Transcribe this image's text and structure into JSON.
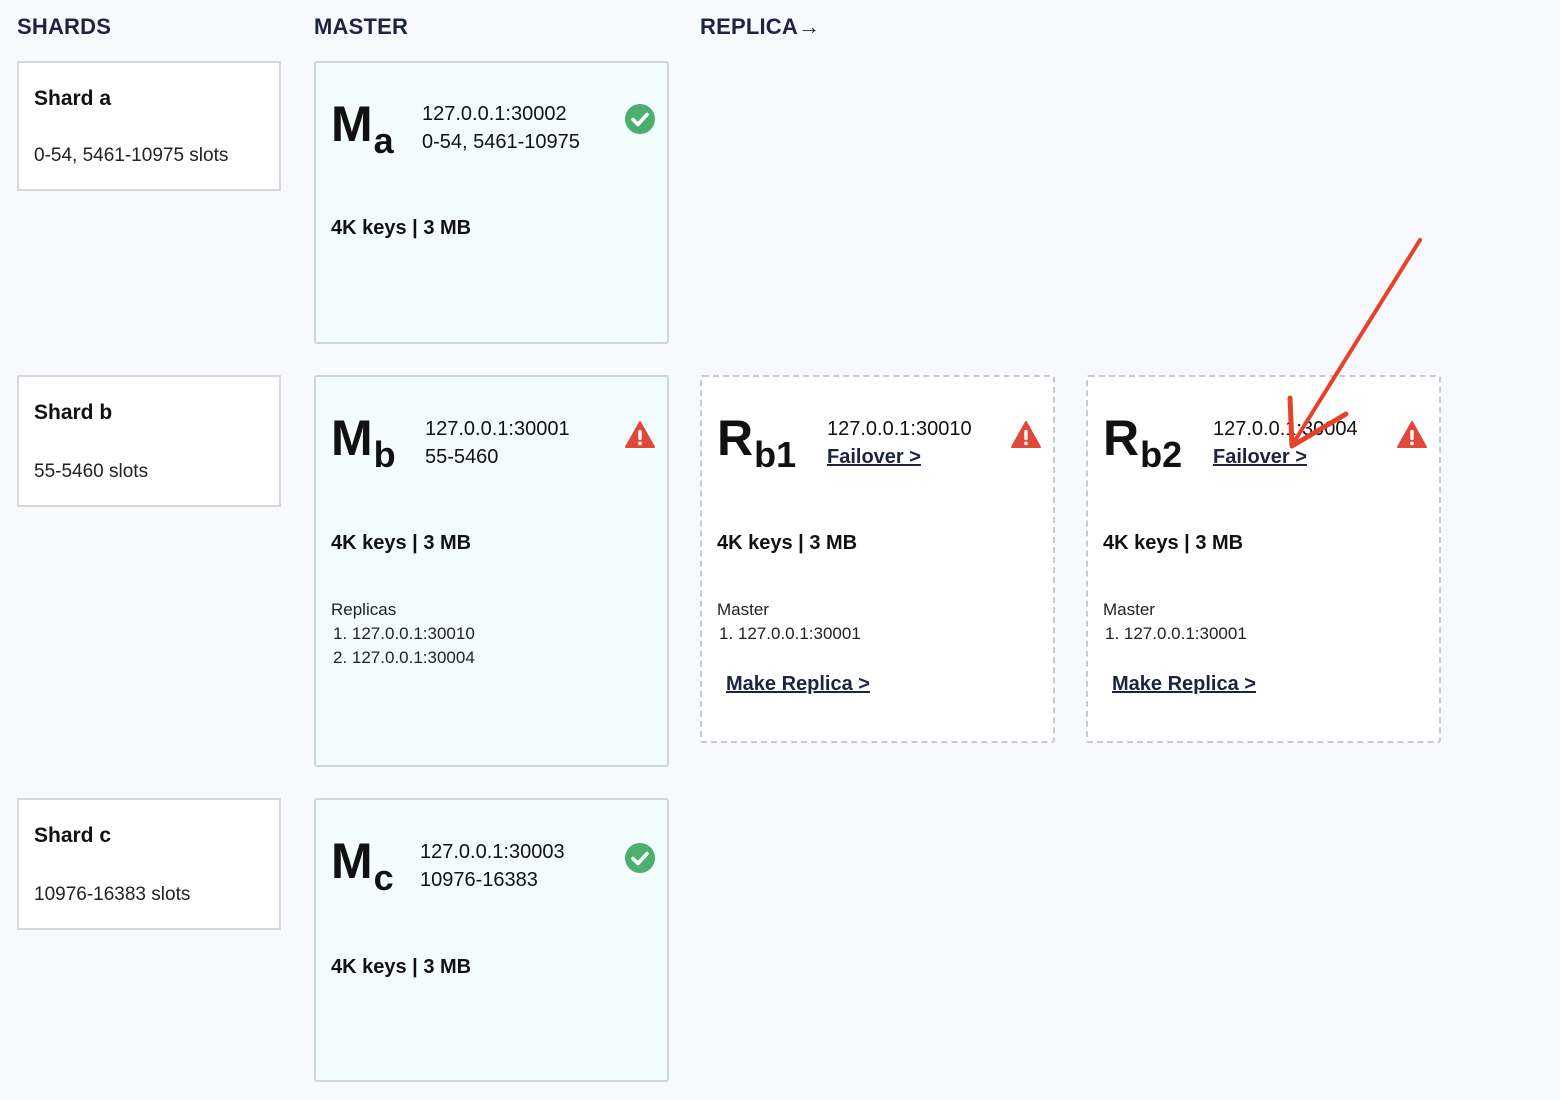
{
  "headers": {
    "shards": "SHARDS",
    "master": "MASTER",
    "replica": "REPLICA→"
  },
  "shards": [
    {
      "name": "Shard a",
      "slots": "0-54, 5461-10975 slots"
    },
    {
      "name": "Shard b",
      "slots": "55-5460 slots"
    },
    {
      "name": "Shard c",
      "slots": "10976-16383 slots"
    }
  ],
  "masters": [
    {
      "letter": "M",
      "sub": "a",
      "address": "127.0.0.1:30002",
      "range": "0-54, 5461-10975",
      "status": "ok",
      "stats": "4K keys | 3 MB"
    },
    {
      "letter": "M",
      "sub": "b",
      "address": "127.0.0.1:30001",
      "range": "55-5460",
      "status": "warning",
      "stats": "4K keys | 3 MB",
      "replicas_title": "Replicas",
      "replicas": [
        "1. 127.0.0.1:30010",
        "2. 127.0.0.1:30004"
      ]
    },
    {
      "letter": "M",
      "sub": "c",
      "address": "127.0.0.1:30003",
      "range": "10976-16383",
      "status": "ok",
      "stats": "4K keys | 3 MB"
    }
  ],
  "replicas": [
    {
      "letter": "R",
      "sub": "b1",
      "address": "127.0.0.1:30010",
      "failover": "Failover >",
      "status": "warning",
      "stats": "4K keys | 3 MB",
      "master_title": "Master",
      "master": "1. 127.0.0.1:30001",
      "action": "Make Replica >"
    },
    {
      "letter": "R",
      "sub": "b2",
      "address": "127.0.0.1:30004",
      "failover": "Failover >",
      "status": "warning",
      "stats": "4K keys | 3 MB",
      "master_title": "Master",
      "master": "1. 127.0.0.1:30001",
      "action": "Make Replica >"
    }
  ],
  "colors": {
    "ok": "#4caf6e",
    "warning": "#e0483a",
    "annotation": "#e5412b"
  }
}
